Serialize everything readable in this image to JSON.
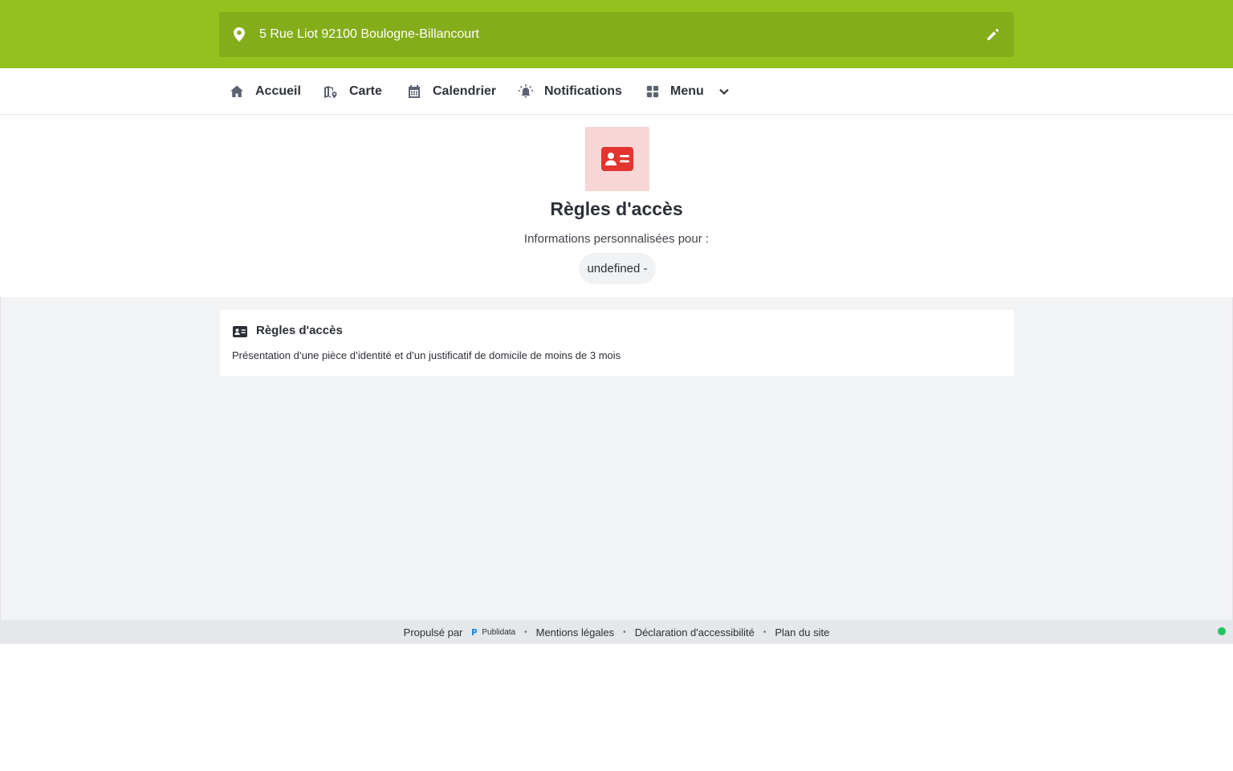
{
  "topbar": {
    "address": "5 Rue Liot 92100 Boulogne-Billancourt",
    "brand_color": "#95c11f"
  },
  "nav": {
    "items": [
      {
        "label": "Accueil",
        "icon": "home-icon"
      },
      {
        "label": "Carte",
        "icon": "map-icon"
      },
      {
        "label": "Calendrier",
        "icon": "calendar-icon"
      },
      {
        "label": "Notifications",
        "icon": "bell-alert-icon"
      },
      {
        "label": "Menu",
        "icon": "grid-icon"
      }
    ]
  },
  "header": {
    "icon": "id-card-icon",
    "icon_color": "#e3342f",
    "title": "Règles d'accès",
    "subtitle": "Informations personnalisées pour :",
    "pill": "undefined -"
  },
  "card": {
    "icon": "id-card-icon",
    "title": "Règles d'accès",
    "text": "Présentation d’une pièce d’identité et d’un justificatif de domicile de moins de 3 mois"
  },
  "footer": {
    "powered_by": "Propulsé par",
    "brand": "Publidata",
    "links": [
      "Mentions légales",
      "Déclaration d'accessibilité",
      "Plan du site"
    ],
    "status_color": "#22c55e"
  }
}
